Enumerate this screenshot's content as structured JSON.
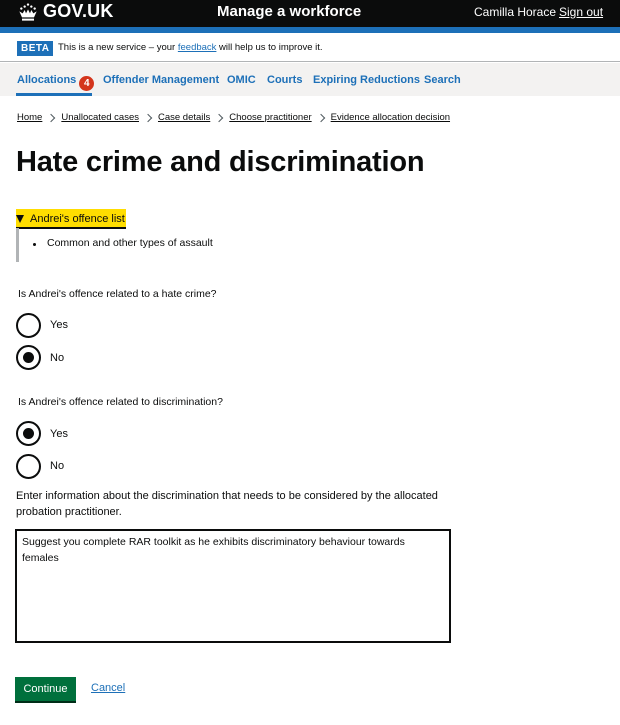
{
  "header": {
    "logo_text": "GOV.UK",
    "service_name": "Manage a workforce",
    "user_name": "Camilla Horace",
    "sign_out": "Sign out"
  },
  "phase_banner": {
    "tag": "BETA",
    "text_before": "This is a new service – your ",
    "link": "feedback",
    "text_after": " will help us to improve it."
  },
  "nav": {
    "items": [
      {
        "label": "Allocations",
        "badge": "4",
        "active": true
      },
      {
        "label": "Offender Management"
      },
      {
        "label": "OMIC"
      },
      {
        "label": "Courts"
      },
      {
        "label": "Expiring Reductions"
      },
      {
        "label": "Search"
      }
    ]
  },
  "breadcrumbs": [
    "Home",
    "Unallocated cases",
    "Case details",
    "Choose practitioner",
    "Evidence allocation decision"
  ],
  "page_title": "Hate crime and discrimination",
  "details": {
    "summary": "Andrei's offence list",
    "items": [
      "Common and other types of assault"
    ]
  },
  "question_hate_crime": {
    "legend": "Is Andrei's offence related to a hate crime?",
    "options": [
      {
        "label": "Yes",
        "checked": false
      },
      {
        "label": "No",
        "checked": true
      }
    ]
  },
  "question_discrimination": {
    "legend": "Is Andrei's offence related to discrimination?",
    "options": [
      {
        "label": "Yes",
        "checked": true
      },
      {
        "label": "No",
        "checked": false
      }
    ]
  },
  "discrimination_info": {
    "label": "Enter information about the discrimination that needs to be considered by the allocated probation practitioner.",
    "value": "Suggest you complete RAR toolkit as he exhibits discriminatory behaviour towards females"
  },
  "actions": {
    "continue": "Continue",
    "cancel": "Cancel"
  },
  "colors": {
    "header_bg": "#0b0c0c",
    "brand_blue": "#1d70b8",
    "focus_yellow": "#ffdd00",
    "badge_red": "#d4351c",
    "button_green": "#00703c"
  }
}
